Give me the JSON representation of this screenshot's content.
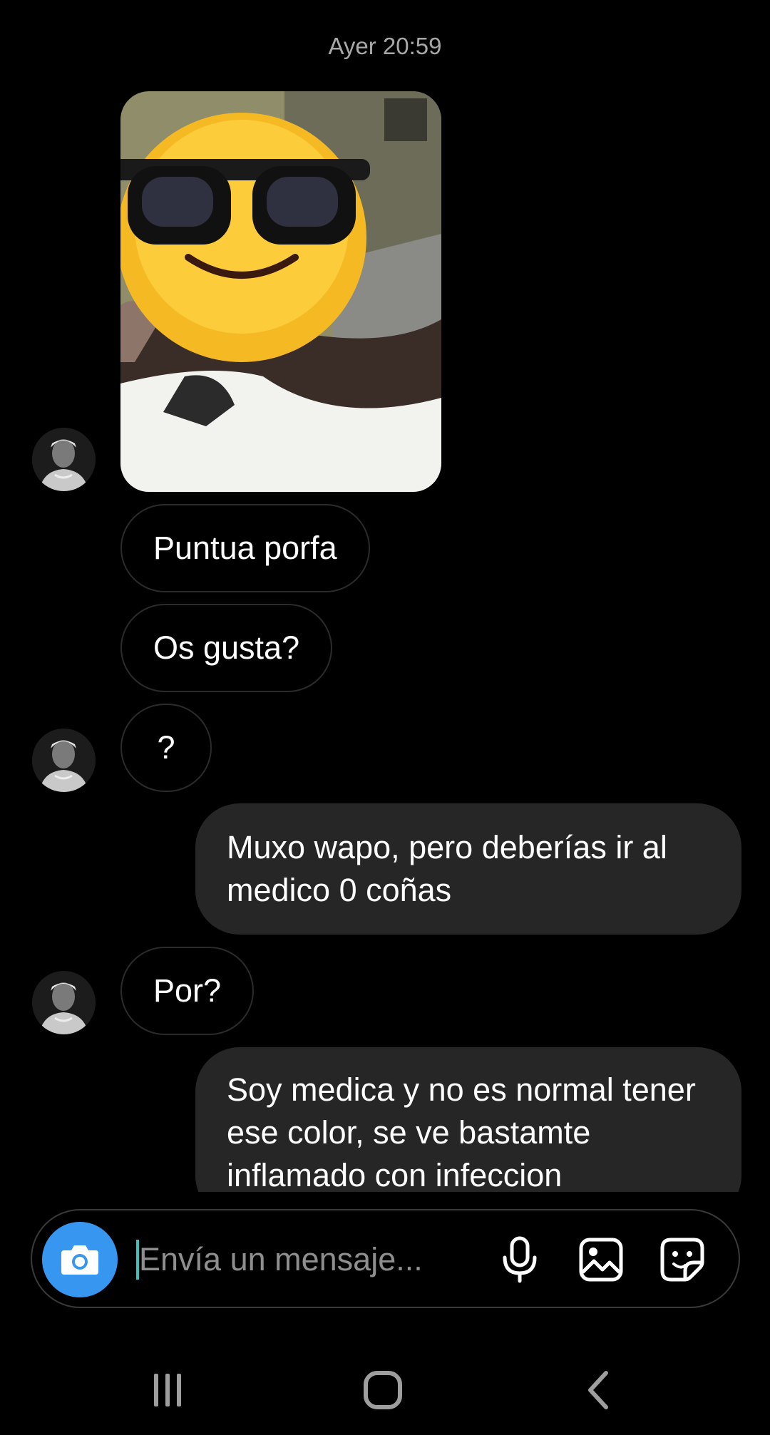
{
  "chat": {
    "timestamp": "Ayer 20:59",
    "messages": {
      "m1": {
        "text": "Puntua porfa"
      },
      "m2": {
        "text": "Os gusta?"
      },
      "m3": {
        "text": "?"
      },
      "m4": {
        "text": "Muxo wapo, pero deberías ir al medico 0 coñas"
      },
      "m5": {
        "text": "Por?"
      },
      "m6": {
        "text": "Soy medica y no es normal tener ese color, se ve bastamte inflamado con infeccion"
      }
    }
  },
  "composer": {
    "placeholder": "Envía un mensaje...",
    "icons": [
      "camera-icon",
      "microphone-icon",
      "gallery-icon",
      "sticker-icon"
    ]
  },
  "navbar": {
    "icons": [
      "recents-icon",
      "home-icon",
      "back-icon"
    ]
  },
  "colors": {
    "background": "#000000",
    "outgoing_bubble": "#262626",
    "incoming_border": "#2b2b2b",
    "accent": "#3797f0",
    "caret": "#3fc0bd",
    "timestamp": "#a8a8a8"
  }
}
